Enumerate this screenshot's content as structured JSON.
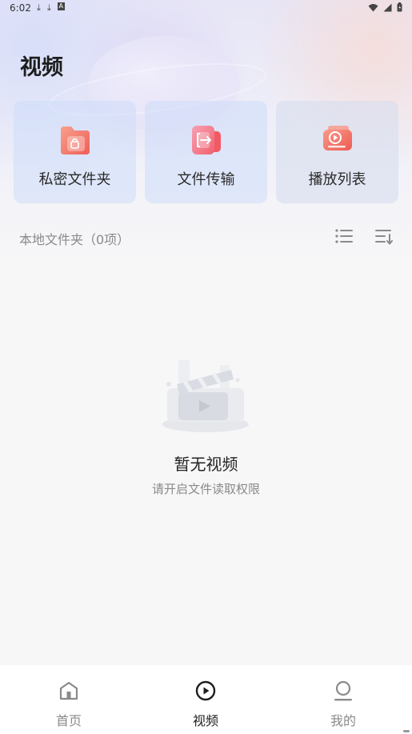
{
  "status_bar": {
    "time": "6:02",
    "left_icons": [
      "download-icon",
      "download-icon",
      "text-a-icon"
    ],
    "right_icons": [
      "wifi-icon",
      "signal-icon",
      "battery-icon"
    ]
  },
  "header": {
    "title": "视频"
  },
  "quick_actions": [
    {
      "label": "私密文件夹",
      "icon": "private-folder-icon"
    },
    {
      "label": "文件传输",
      "icon": "file-transfer-icon"
    },
    {
      "label": "播放列表",
      "icon": "playlist-icon"
    }
  ],
  "section": {
    "title": "本地文件夹（0项）"
  },
  "empty_state": {
    "title": "暂无视频",
    "subtitle": "请开启文件读取权限"
  },
  "bottom_nav": [
    {
      "label": "首页",
      "icon": "home-icon",
      "active": false
    },
    {
      "label": "视频",
      "icon": "play-circle-icon",
      "active": true
    },
    {
      "label": "我的",
      "icon": "profile-icon",
      "active": false
    }
  ],
  "colors": {
    "accent_red": "#f26a5e",
    "accent_pink": "#f57a8a",
    "card_bg": "#d7e3fa",
    "text_primary": "#1e1e1e",
    "text_secondary": "#8a8a8a"
  }
}
